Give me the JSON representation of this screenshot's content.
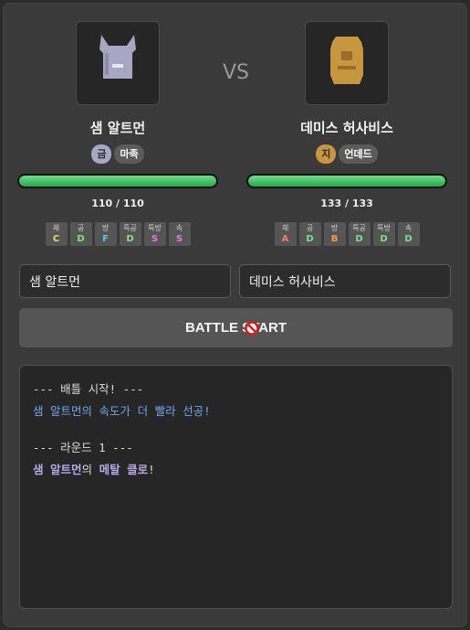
{
  "vs_label": "VS",
  "left": {
    "name": "샘 알트먼",
    "input_value": "샘 알트먼",
    "types": [
      {
        "label": "금",
        "bg": "#a9a6c4",
        "fg": "#2b2b2b"
      },
      {
        "label": "마족",
        "bg": "#5b5b5b",
        "fg": "#ffffff"
      }
    ],
    "hp_text": "110 / 110",
    "hp_fraction": 1.0,
    "stats": [
      {
        "label": "체",
        "grade": "C",
        "color": "#e4e06a"
      },
      {
        "label": "공",
        "grade": "D",
        "color": "#7ee08a"
      },
      {
        "label": "방",
        "grade": "F",
        "color": "#68c0e8"
      },
      {
        "label": "특공",
        "grade": "D",
        "color": "#7ee08a"
      },
      {
        "label": "특방",
        "grade": "S",
        "color": "#e47be0"
      },
      {
        "label": "속",
        "grade": "S",
        "color": "#e47be0"
      }
    ]
  },
  "right": {
    "name": "데미스 허사비스",
    "input_value": "데미스 허사비스",
    "types": [
      {
        "label": "지",
        "bg": "#c8963f",
        "fg": "#2b2b2b"
      },
      {
        "label": "언데드",
        "bg": "#5b5b5b",
        "fg": "#ffffff"
      }
    ],
    "hp_text": "133 / 133",
    "hp_fraction": 1.0,
    "stats": [
      {
        "label": "체",
        "grade": "A",
        "color": "#ef7b6d"
      },
      {
        "label": "공",
        "grade": "D",
        "color": "#7ee08a"
      },
      {
        "label": "방",
        "grade": "B",
        "color": "#f0a04b"
      },
      {
        "label": "특공",
        "grade": "D",
        "color": "#7ee08a"
      },
      {
        "label": "특방",
        "grade": "D",
        "color": "#7ee08a"
      },
      {
        "label": "속",
        "grade": "D",
        "color": "#7ee08a"
      }
    ]
  },
  "start_button_label": "BATTLE START",
  "log": [
    {
      "segments": [
        {
          "text": "--- 배틀 시작! ---",
          "color": "#dcdcdc"
        }
      ]
    },
    {
      "segments": [
        {
          "text": "샘 알트먼의 속도가 더 빨라 선공!",
          "color": "#6ea8f0"
        }
      ]
    },
    {
      "gap": true
    },
    {
      "segments": [
        {
          "text": "--- 라운드 1 ---",
          "color": "#dcdcdc"
        }
      ]
    },
    {
      "segments": [
        {
          "text": "샘 알트먼",
          "color": "#b6a8e8",
          "bold": true
        },
        {
          "text": "의 ",
          "color": "#dcdcdc"
        },
        {
          "text": "메탈 클로",
          "color": "#b6a8e8",
          "bold": true
        },
        {
          "text": "!",
          "color": "#dcdcdc"
        }
      ]
    }
  ]
}
